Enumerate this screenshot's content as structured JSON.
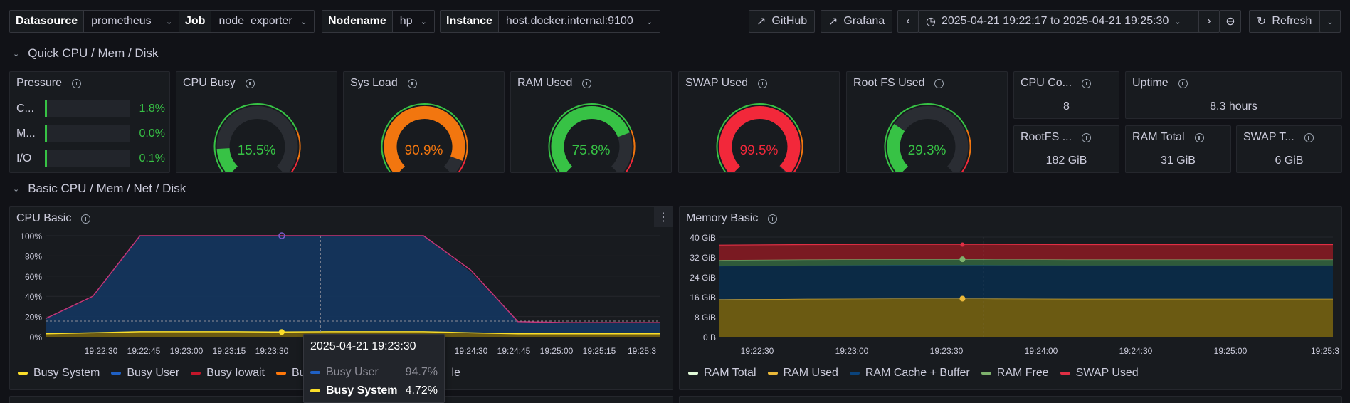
{
  "variables": [
    {
      "label": "Datasource",
      "value": "prometheus"
    },
    {
      "label": "Job",
      "value": "node_exporter"
    },
    {
      "label": "Nodename",
      "value": "hp"
    },
    {
      "label": "Instance",
      "value": "host.docker.internal:9100"
    }
  ],
  "toolbar": {
    "github": "GitHub",
    "grafana": "Grafana",
    "time_range": "2025-04-21 19:22:17 to 2025-04-21 19:25:30",
    "refresh": "Refresh"
  },
  "rows": {
    "quick": "Quick CPU / Mem / Disk",
    "basic": "Basic CPU / Mem / Net / Disk"
  },
  "pressure": {
    "title": "Pressure",
    "items": [
      {
        "label": "C...",
        "value": "1.8%"
      },
      {
        "label": "M...",
        "value": "0.0%"
      },
      {
        "label": "I/O",
        "value": "0.1%"
      }
    ]
  },
  "gauges": [
    {
      "title": "CPU Busy",
      "value": "15.5%",
      "pct": 15.5,
      "color": "#37c245"
    },
    {
      "title": "Sys Load",
      "value": "90.9%",
      "pct": 90.9,
      "color": "#f2760f"
    },
    {
      "title": "RAM Used",
      "value": "75.8%",
      "pct": 75.8,
      "color": "#37c245"
    },
    {
      "title": "SWAP Used",
      "value": "99.5%",
      "pct": 99.5,
      "color": "#f2283a"
    },
    {
      "title": "Root FS Used",
      "value": "29.3%",
      "pct": 29.3,
      "color": "#37c245"
    }
  ],
  "stats": [
    {
      "title": "CPU Co...",
      "value": "8"
    },
    {
      "title": "Uptime",
      "value": "8.3 hours"
    },
    {
      "title": "RootFS ...",
      "value": "182 GiB"
    },
    {
      "title": "RAM Total",
      "value": "31 GiB"
    },
    {
      "title": "SWAP T...",
      "value": "6 GiB"
    }
  ],
  "cpu_panel": {
    "title": "CPU Basic",
    "legend": [
      {
        "name": "Busy System",
        "color": "#fade2a"
      },
      {
        "name": "Busy User",
        "color": "#1f60c4"
      },
      {
        "name": "Busy Iowait",
        "color": "#c4162a"
      },
      {
        "name": "Busy",
        "color": "#ff780a"
      },
      {
        "name": "le",
        "color": ""
      }
    ]
  },
  "mem_panel": {
    "title": "Memory Basic",
    "legend": [
      {
        "name": "RAM Total",
        "color": "#e0f9d7"
      },
      {
        "name": "RAM Used",
        "color": "#eab839"
      },
      {
        "name": "RAM Cache + Buffer",
        "color": "#052b51"
      },
      {
        "name": "RAM Free",
        "color": "#7eb26d"
      },
      {
        "name": "SWAP Used",
        "color": "#e02f44"
      }
    ]
  },
  "tooltip": {
    "time": "2025-04-21 19:23:30",
    "rows": [
      {
        "name": "Busy User",
        "value": "94.7%",
        "color": "#1f60c4"
      },
      {
        "name": "Busy System",
        "value": "4.72%",
        "color": "#fade2a"
      }
    ]
  },
  "chart_data": [
    {
      "type": "area",
      "title": "CPU Basic",
      "x": [
        "19:22:17",
        "19:22:30",
        "19:22:45",
        "19:23:00",
        "19:23:15",
        "19:23:30",
        "19:23:45",
        "19:24:00",
        "19:24:15",
        "19:24:30",
        "19:24:45",
        "19:25:00",
        "19:25:15",
        "19:25:30"
      ],
      "xticks": [
        "19:22:30",
        "19:22:45",
        "19:23:00",
        "19:23:15",
        "19:23:30",
        "",
        "",
        "",
        "19:24:30",
        "19:24:45",
        "19:25:00",
        "19:25:15",
        "19:25:3"
      ],
      "yticks": [
        "100%",
        "80%",
        "60%",
        "40%",
        "20%",
        "0%"
      ],
      "ylim": [
        0,
        100
      ],
      "series": [
        {
          "name": "Busy User",
          "values": [
            15,
            35,
            95,
            95,
            95,
            95,
            95,
            95,
            95,
            60,
            12,
            11,
            11,
            11
          ]
        },
        {
          "name": "Busy System",
          "values": [
            3,
            4,
            5,
            5,
            5,
            4.72,
            5,
            5,
            5,
            4,
            3,
            3,
            3,
            3
          ]
        },
        {
          "name": "Busy Iowait",
          "values": [
            0,
            0,
            0,
            0,
            0,
            0,
            0,
            0,
            0,
            0,
            0,
            0,
            0,
            0
          ]
        }
      ],
      "total": [
        18,
        40,
        100,
        100,
        100,
        100,
        100,
        100,
        100,
        66,
        15,
        14,
        14,
        14
      ]
    },
    {
      "type": "area",
      "title": "Memory Basic",
      "x": [
        "19:22:17",
        "19:22:30",
        "19:23:00",
        "19:23:30",
        "19:24:00",
        "19:24:30",
        "19:25:00",
        "19:25:30"
      ],
      "xticks": [
        "19:22:30",
        "19:23:00",
        "19:23:30",
        "19:24:00",
        "19:24:30",
        "19:25:00",
        "19:25:3"
      ],
      "yticks": [
        "40 GiB",
        "32 GiB",
        "24 GiB",
        "16 GiB",
        "8 GiB",
        "0 B"
      ],
      "ylim": [
        0,
        40
      ],
      "series": [
        {
          "name": "RAM Used",
          "values": [
            15,
            15.2,
            15.3,
            15.3,
            15.2,
            15.2,
            15.2,
            15.2
          ]
        },
        {
          "name": "RAM Cache + Buffer",
          "values": [
            13.4,
            13.4,
            13.4,
            13.4,
            13.4,
            13.4,
            13.4,
            13.4
          ]
        },
        {
          "name": "RAM Free",
          "values": [
            2.4,
            2.4,
            2.4,
            2.4,
            2.4,
            2.4,
            2.4,
            2.4
          ]
        },
        {
          "name": "SWAP Used",
          "values": [
            6,
            6,
            6,
            6,
            6,
            6,
            6,
            6
          ]
        }
      ]
    }
  ]
}
